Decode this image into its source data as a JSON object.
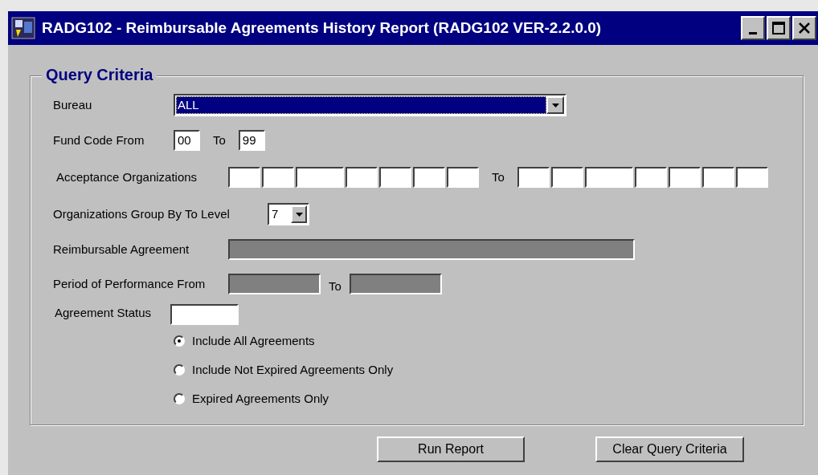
{
  "window": {
    "title": "RADG102 - Reimbursable Agreements History Report (RADG102 VER-2.2.0.0)"
  },
  "window_buttons": [
    {
      "kind": "minimize"
    },
    {
      "kind": "maximize"
    },
    {
      "kind": "close"
    }
  ],
  "query_criteria": {
    "title": "Query Criteria",
    "bureau": {
      "label": "Bureau",
      "value": "ALL"
    },
    "fund_code": {
      "label": "Fund Code From",
      "from": "00",
      "to_label": "To",
      "to": "99"
    },
    "acceptance_organizations": {
      "label": "Acceptance Organizations",
      "to_label": "To"
    },
    "group_by_level": {
      "label": "Organizations Group By To Level",
      "value": "7"
    },
    "reimbursable_agreement": {
      "label": "Reimbursable Agreement",
      "disabled": true
    },
    "period_of_performance": {
      "label": "Period of Performance From",
      "to_label": "To",
      "disabled": true
    },
    "agreement_status": {
      "label": "Agreement Status"
    },
    "options": [
      {
        "label": "Include All Agreements",
        "selected": true
      },
      {
        "label": "Include Not Expired Agreements Only",
        "selected": false
      },
      {
        "label": "Expired Agreements Only",
        "selected": false
      }
    ]
  },
  "buttons": [
    "Run Report",
    "Clear Query Criteria"
  ]
}
